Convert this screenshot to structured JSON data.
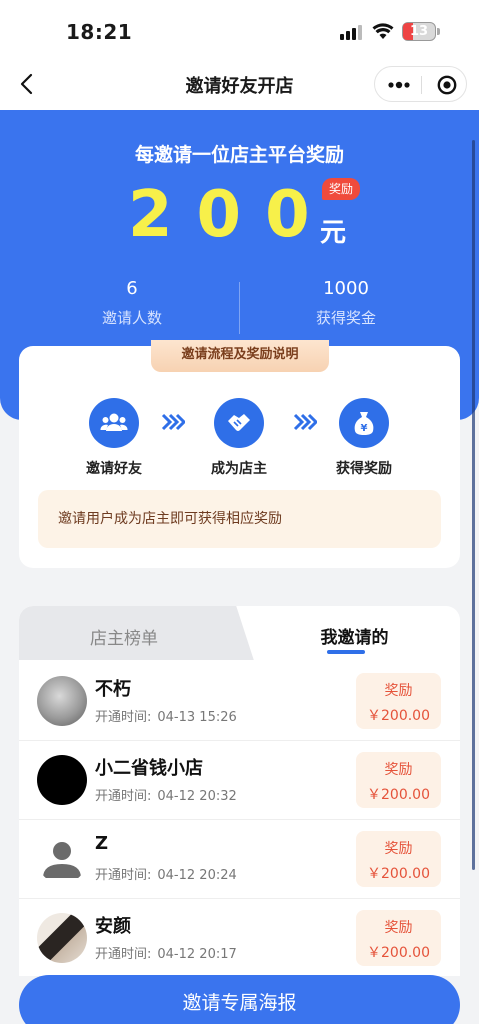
{
  "status_bar": {
    "time": "18:21",
    "battery": "13"
  },
  "nav": {
    "title": "邀请好友开店",
    "back_icon": "chevron-left-icon",
    "more_icon": "more-dots-icon",
    "close_icon": "target-icon"
  },
  "hero": {
    "headline": "每邀请一位店主平台奖励",
    "amount": "200",
    "unit": "元",
    "badge": "奖励",
    "stats": [
      {
        "value": "6",
        "label": "邀请人数"
      },
      {
        "value": "1000",
        "label": "获得奖金"
      }
    ]
  },
  "process": {
    "ribbon": "邀请流程及奖励说明",
    "steps": [
      {
        "label": "邀请好友",
        "icon": "people-icon"
      },
      {
        "label": "成为店主",
        "icon": "handshake-icon"
      },
      {
        "label": "获得奖励",
        "icon": "money-bag-icon"
      }
    ],
    "note": "邀请用户成为店主即可获得相应奖励"
  },
  "tabs": {
    "left": "店主榜单",
    "right": "我邀请的",
    "active": "right"
  },
  "list": {
    "time_label": "开通时间:",
    "reward_label": "奖励",
    "rows": [
      {
        "name": "不朽",
        "time": "04-13 15:26",
        "reward": "￥200.00"
      },
      {
        "name": "小二省钱小店",
        "time": "04-12 20:32",
        "reward": "￥200.00"
      },
      {
        "name": "Z",
        "time": "04-12 20:24",
        "reward": "￥200.00"
      },
      {
        "name": "安颜",
        "time": "04-12 20:17",
        "reward": "￥200.00"
      }
    ]
  },
  "bottom_button": "邀请专属海报",
  "colors": {
    "primary": "#3a74ee",
    "accent_yellow": "#f7f04a",
    "reward_red": "#e5533a",
    "badge_red": "#f04b3c"
  }
}
